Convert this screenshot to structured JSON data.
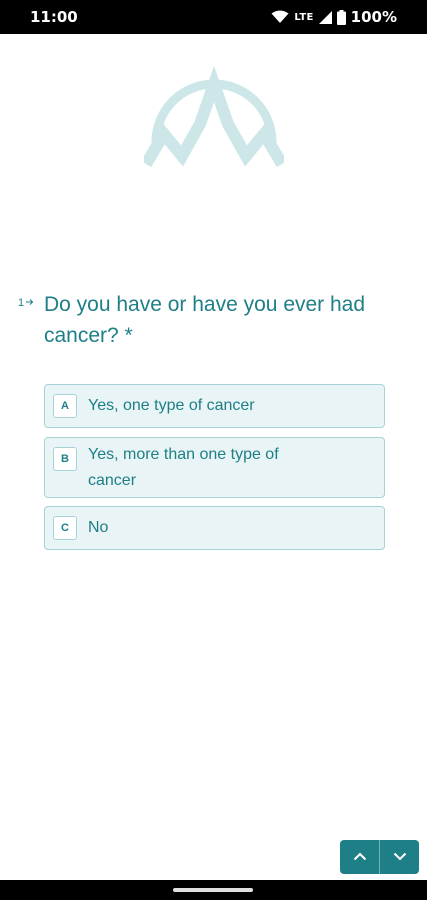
{
  "status_bar": {
    "time": "11:00",
    "network": "LTE",
    "battery": "100%",
    "icons": [
      "wifi-icon",
      "signal-icon",
      "battery-icon"
    ]
  },
  "logo": {
    "icon": "mountain-logo-icon"
  },
  "question": {
    "number": "1",
    "arrow_icon": "arrow-right-icon",
    "text": "Do you have or have you ever had cancer? *"
  },
  "options": [
    {
      "key": "A",
      "label": "Yes, one type of cancer"
    },
    {
      "key": "B",
      "label": "Yes, more than one type of cancer"
    },
    {
      "key": "C",
      "label": "No"
    }
  ],
  "nav": {
    "up_icon": "chevron-up-icon",
    "down_icon": "chevron-down-icon"
  },
  "colors": {
    "accent": "#1f7f86",
    "option_background": "#e8f4f5",
    "option_border": "#a7d3d6",
    "logo": "#cde7e9"
  }
}
